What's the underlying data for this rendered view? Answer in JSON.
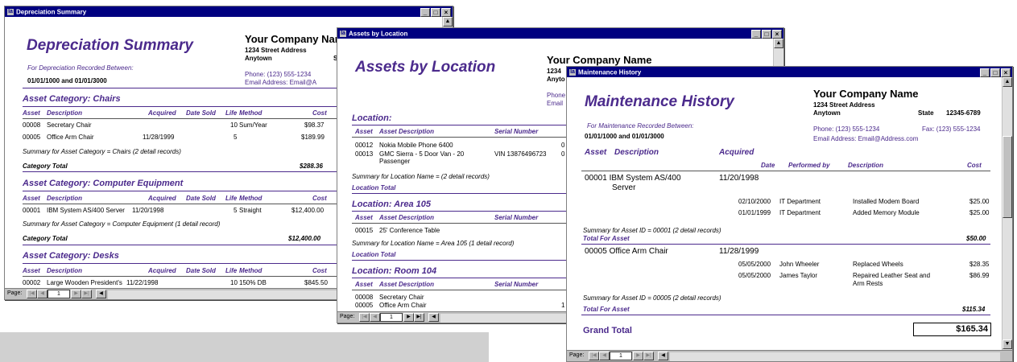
{
  "colors": {
    "title_bar": "#000080",
    "report_accent": "#4b2a8c"
  },
  "icons": {
    "app": "access-report-icon"
  },
  "win1": {
    "title": "Depreciation Summary",
    "report_title": "Depreciation Summary",
    "company": {
      "name": "Your Company Nam",
      "street": "1234 Street Address",
      "city": "Anytown",
      "state_partial": "S",
      "phone": "Phone: (123) 555-1234",
      "email": "Email Address:  Email@A"
    },
    "period_label": "For Depreciation Recorded Between:",
    "period_value": "01/01/1000 and 01/01/3000",
    "cols": {
      "asset": "Asset",
      "description": "Description",
      "acquired": "Acquired",
      "date_sold": "Date Sold",
      "life": "Life",
      "method": "Method",
      "cost": "Cost"
    },
    "cat1": {
      "heading": "Asset Category: Chairs",
      "rows": [
        {
          "asset": "00008",
          "desc": "Secretary Chair",
          "acquired": "",
          "life": "10",
          "method": "Sum/Year",
          "cost": "$98.37"
        },
        {
          "asset": "00005",
          "desc": "Office Arm Chair",
          "acquired": "11/28/1999",
          "life": "5",
          "method": "",
          "cost": "$189.99"
        }
      ],
      "summary": "Summary for Asset Category =  Chairs  (2 detail records)",
      "total_label": "Category Total",
      "total": "$288.36"
    },
    "cat2": {
      "heading": "Asset Category: Computer Equipment",
      "rows": [
        {
          "asset": "00001",
          "desc": "IBM System AS/400 Server",
          "acquired": "11/20/1998",
          "life": "5",
          "method": "Straight",
          "cost": "$12,400.00"
        }
      ],
      "summary": "Summary for Asset Category =  Computer Equipment  (1 detail record)",
      "total_label": "Category Total",
      "total": "$12,400.00"
    },
    "cat3": {
      "heading": "Asset Category: Desks",
      "rows": [
        {
          "asset": "00002",
          "desc": "Large Wooden President's",
          "acquired": "11/22/1998",
          "life": "10",
          "method": "150% DB",
          "cost": "$845.50"
        }
      ]
    },
    "nav": {
      "page_label": "Page:",
      "page": "1"
    }
  },
  "win2": {
    "title": "Assets by Location",
    "report_title": "Assets by Location",
    "company": {
      "name": "Your Company Name",
      "street": "1234",
      "city": "Anyto",
      "phone": "Phone",
      "email": "Email"
    },
    "loc1": {
      "heading": "Location:",
      "cols": {
        "asset": "Asset",
        "description": "Asset Description",
        "serial": "Serial Number"
      },
      "rows": [
        {
          "asset": "00012",
          "desc": "Nokia Mobile Phone 6400",
          "serial": "",
          "extra": "0"
        },
        {
          "asset": "00013",
          "desc": "GMC Sierra - 5 Door Van - 20",
          "desc2": "Passenger",
          "serial": "VIN 13876496723",
          "extra": "0"
        }
      ],
      "summary": "Summary for Location Name =    (2 detail records)",
      "total_label": "Location Total"
    },
    "loc2": {
      "heading": "Location: Area 105",
      "cols": {
        "asset": "Asset",
        "description": "Asset Description",
        "serial": "Serial Number"
      },
      "rows": [
        {
          "asset": "00015",
          "desc": "25' Conference Table"
        }
      ],
      "summary": "Summary for Location Name =  Area 105  (1 detail record)",
      "total_label": "Location Total"
    },
    "loc3": {
      "heading": "Location: Room 104",
      "cols": {
        "asset": "Asset",
        "description": "Asset Description",
        "serial": "Serial Number"
      },
      "rows": [
        {
          "asset": "00008",
          "desc": "Secretary Chair"
        },
        {
          "asset": "00005",
          "desc": "Office Arm Chair",
          "extra": "1"
        }
      ]
    },
    "nav": {
      "page_label": "Page:",
      "page": "1"
    }
  },
  "win3": {
    "title": "Maintenance History",
    "report_title": "Maintenance History",
    "company": {
      "name": "Your Company Name",
      "street": "1234 Street Address",
      "city": "Anytown",
      "state": "State",
      "zip": "12345-6789",
      "phone": "Phone:  (123) 555-1234",
      "fax": "Fax:  (123) 555-1234",
      "email": "Email Address:   Email@Address.com"
    },
    "period_label": "For Maintenance Recorded Between:",
    "period_value": "01/01/1000 and 01/01/3000",
    "cols": {
      "asset": "Asset",
      "description": "Description",
      "acquired": "Acquired",
      "date": "Date",
      "performed_by": "Performed by",
      "desc2": "Description",
      "cost": "Cost"
    },
    "assets": [
      {
        "line1": "00001  IBM System AS/400",
        "line2": "Server",
        "acquired": "11/20/1998",
        "rows": [
          {
            "date": "02/10/2000",
            "by": "IT Department",
            "desc": "Installed Modem Board",
            "cost": "$25.00"
          },
          {
            "date": "01/01/1999",
            "by": "IT Department",
            "desc": "Added Memory Module",
            "cost": "$25.00"
          }
        ],
        "summary": "Summary for Asset ID =  00001  (2 detail records)",
        "total_label": "Total For Asset",
        "total": "$50.00"
      },
      {
        "line1": "00005  Office Arm Chair",
        "acquired": "11/28/1999",
        "rows": [
          {
            "date": "05/05/2000",
            "by": "John Wheeler",
            "desc": "Replaced Wheels",
            "cost": "$28.35"
          },
          {
            "date": "05/05/2000",
            "by": "James Taylor",
            "desc": "Repaired Leather Seat and",
            "desc2": "Arm Rests",
            "cost": "$86.99"
          }
        ],
        "summary": "Summary for Asset ID =  00005  (2 detail records)",
        "total_label": "Total For Asset",
        "total": "$115.34"
      }
    ],
    "grand_total_label": "Grand Total",
    "grand_total": "$165.34",
    "nav": {
      "page_label": "Page:",
      "page": "1"
    }
  }
}
